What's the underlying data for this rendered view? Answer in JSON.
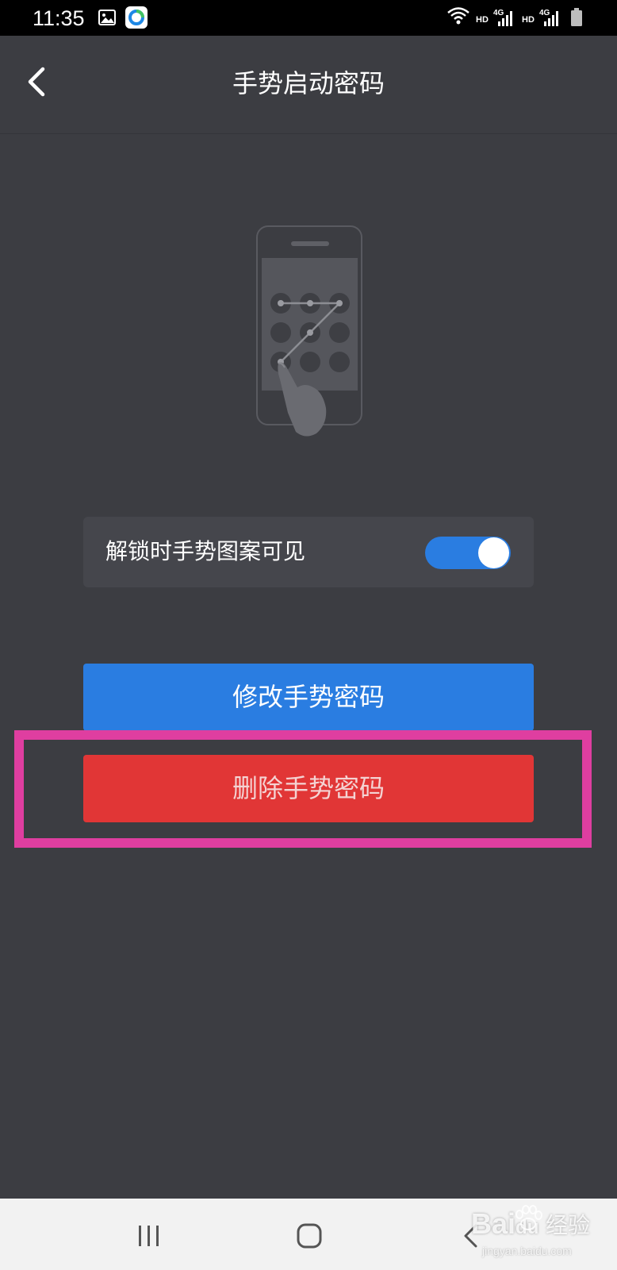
{
  "status_bar": {
    "time": "11:35",
    "icons": [
      "image-icon",
      "app-sync-icon",
      "wifi-icon",
      "hd-4g-signal-icon",
      "hd-4g-signal-icon",
      "battery-icon"
    ],
    "net_label_hd": "HD",
    "net_label_4g": "4G"
  },
  "header": {
    "title": "手势启动密码",
    "back_icon": "chevron-left-icon"
  },
  "illustration": {
    "icon": "phone-gesture-pattern-icon"
  },
  "settings": {
    "pattern_visible": {
      "label": "解锁时手势图案可见",
      "enabled": true
    }
  },
  "actions": {
    "modify_label": "修改手势密码",
    "delete_label": "删除手势密码"
  },
  "nav_bar": {
    "icons": [
      "recent-apps-icon",
      "home-icon",
      "back-icon"
    ]
  },
  "watermark": {
    "brand": "Bai",
    "brand_suffix": "du",
    "jingyan": "经验",
    "url": "jingyan.baidu.com"
  },
  "colors": {
    "background": "#3c3d42",
    "accent_blue": "#2a7de1",
    "danger_red": "#e13636",
    "highlight_pink": "#df3ea0"
  }
}
